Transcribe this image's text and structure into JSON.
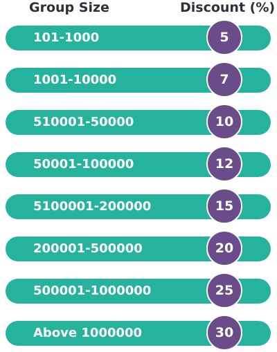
{
  "header": {
    "group_size_label": "Group Size",
    "discount_label": "Discount (%)"
  },
  "colors": {
    "bar": "#25b39e",
    "badge": "#6b4c8a",
    "header_text": "#2f2f3a"
  },
  "rows": [
    {
      "range": "101-1000",
      "discount": "5"
    },
    {
      "range": "1001-10000",
      "discount": "7"
    },
    {
      "range": "510001-50000",
      "discount": "10"
    },
    {
      "range": "50001-100000",
      "discount": "12"
    },
    {
      "range": "5100001-200000",
      "discount": "15"
    },
    {
      "range": "200001-500000",
      "discount": "20"
    },
    {
      "range": "500001-1000000",
      "discount": "25"
    },
    {
      "range": "Above 1000000",
      "discount": "30"
    }
  ]
}
